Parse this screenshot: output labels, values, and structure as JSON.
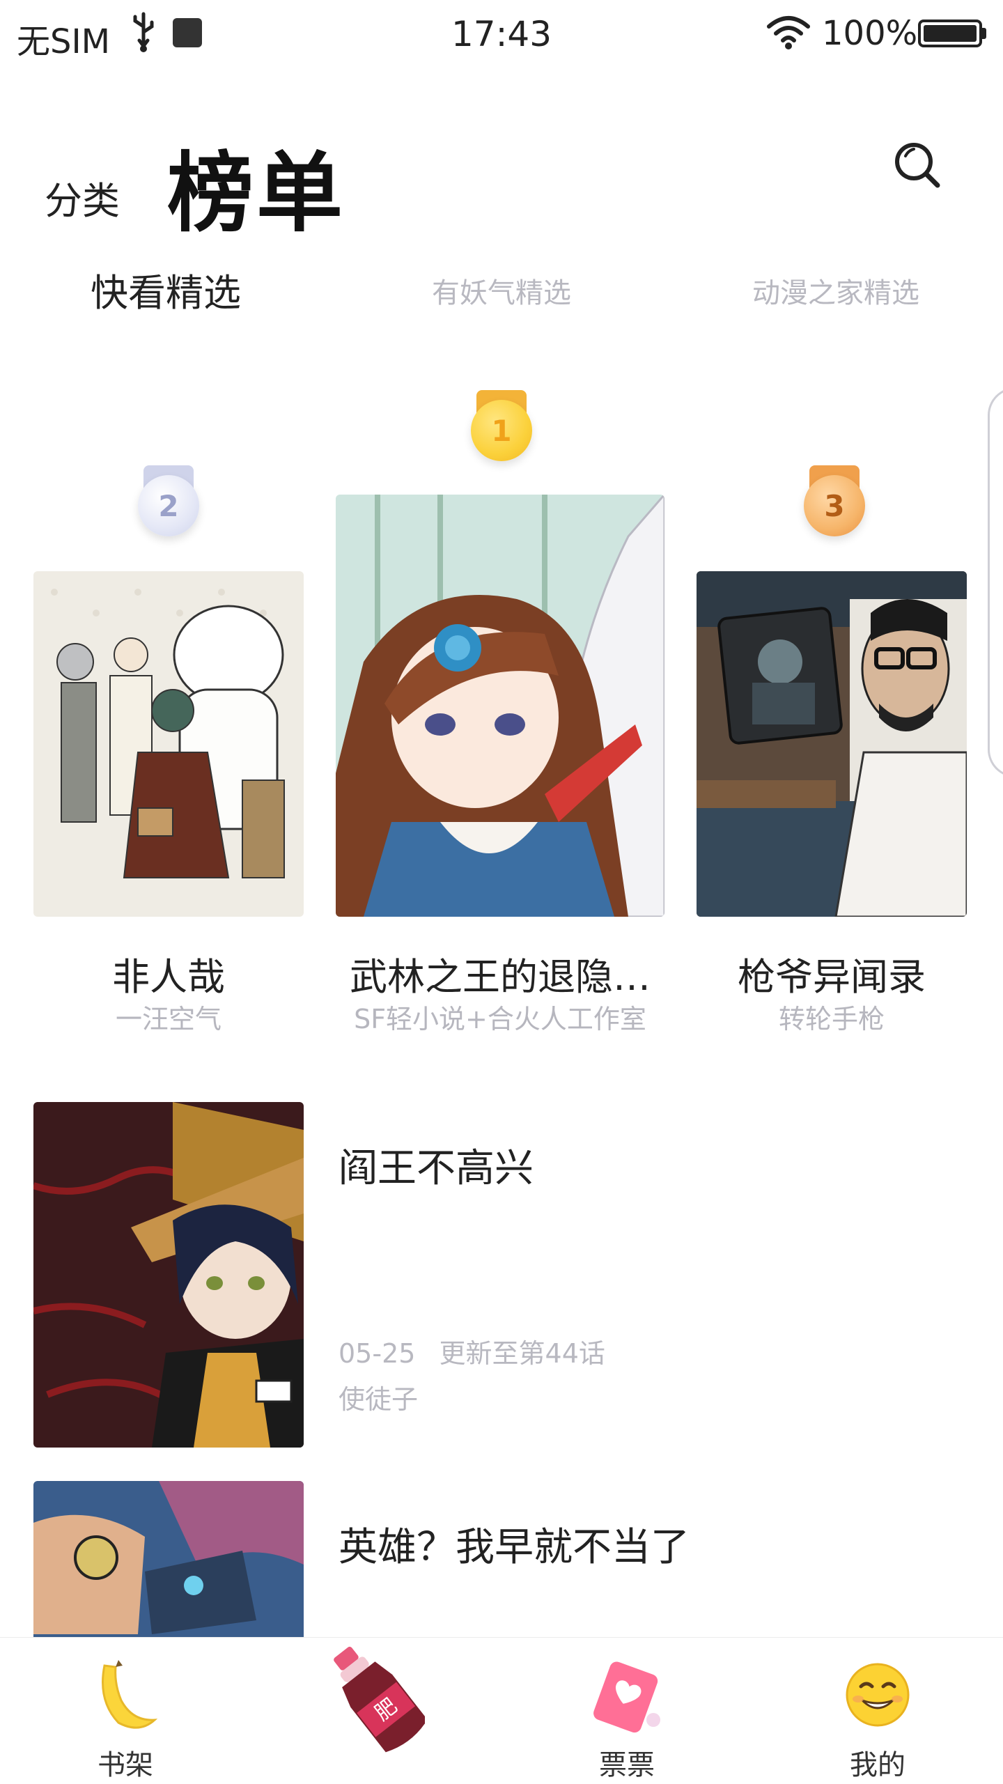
{
  "status_bar": {
    "carrier": "无SIM",
    "time": "17:43",
    "battery": "100%"
  },
  "header": {
    "category_label": "分类",
    "title": "榜单",
    "search_icon": "search-icon"
  },
  "tabs": [
    {
      "label": "快看精选",
      "active": true
    },
    {
      "label": "有妖气精选",
      "active": false
    },
    {
      "label": "动漫之家精选",
      "active": false
    }
  ],
  "podium": [
    {
      "rank": "2",
      "title": "非人哉",
      "author": "一汪空气"
    },
    {
      "rank": "1",
      "title": "武林之王的退隐…",
      "author": "SF轻小说+合火人工作室"
    },
    {
      "rank": "3",
      "title": "枪爷异闻录",
      "author": "转轮手枪"
    }
  ],
  "list": [
    {
      "title": "阎王不高兴",
      "date": "05-25",
      "update": "更新至第44话",
      "author": "使徒子"
    },
    {
      "title": "英雄？我早就不当了"
    }
  ],
  "bottom_nav": [
    {
      "label": "书架",
      "icon": "banana-icon"
    },
    {
      "label": "",
      "icon": "soda-bottle-icon"
    },
    {
      "label": "票票",
      "icon": "ticket-heart-icon"
    },
    {
      "label": "我的",
      "icon": "smiley-face-icon"
    }
  ],
  "colors": {
    "accent_gold": "#fbd13b",
    "silver": "#e4e7f6",
    "bronze": "#f6b56a",
    "inactive_text": "#b8b8c0"
  }
}
